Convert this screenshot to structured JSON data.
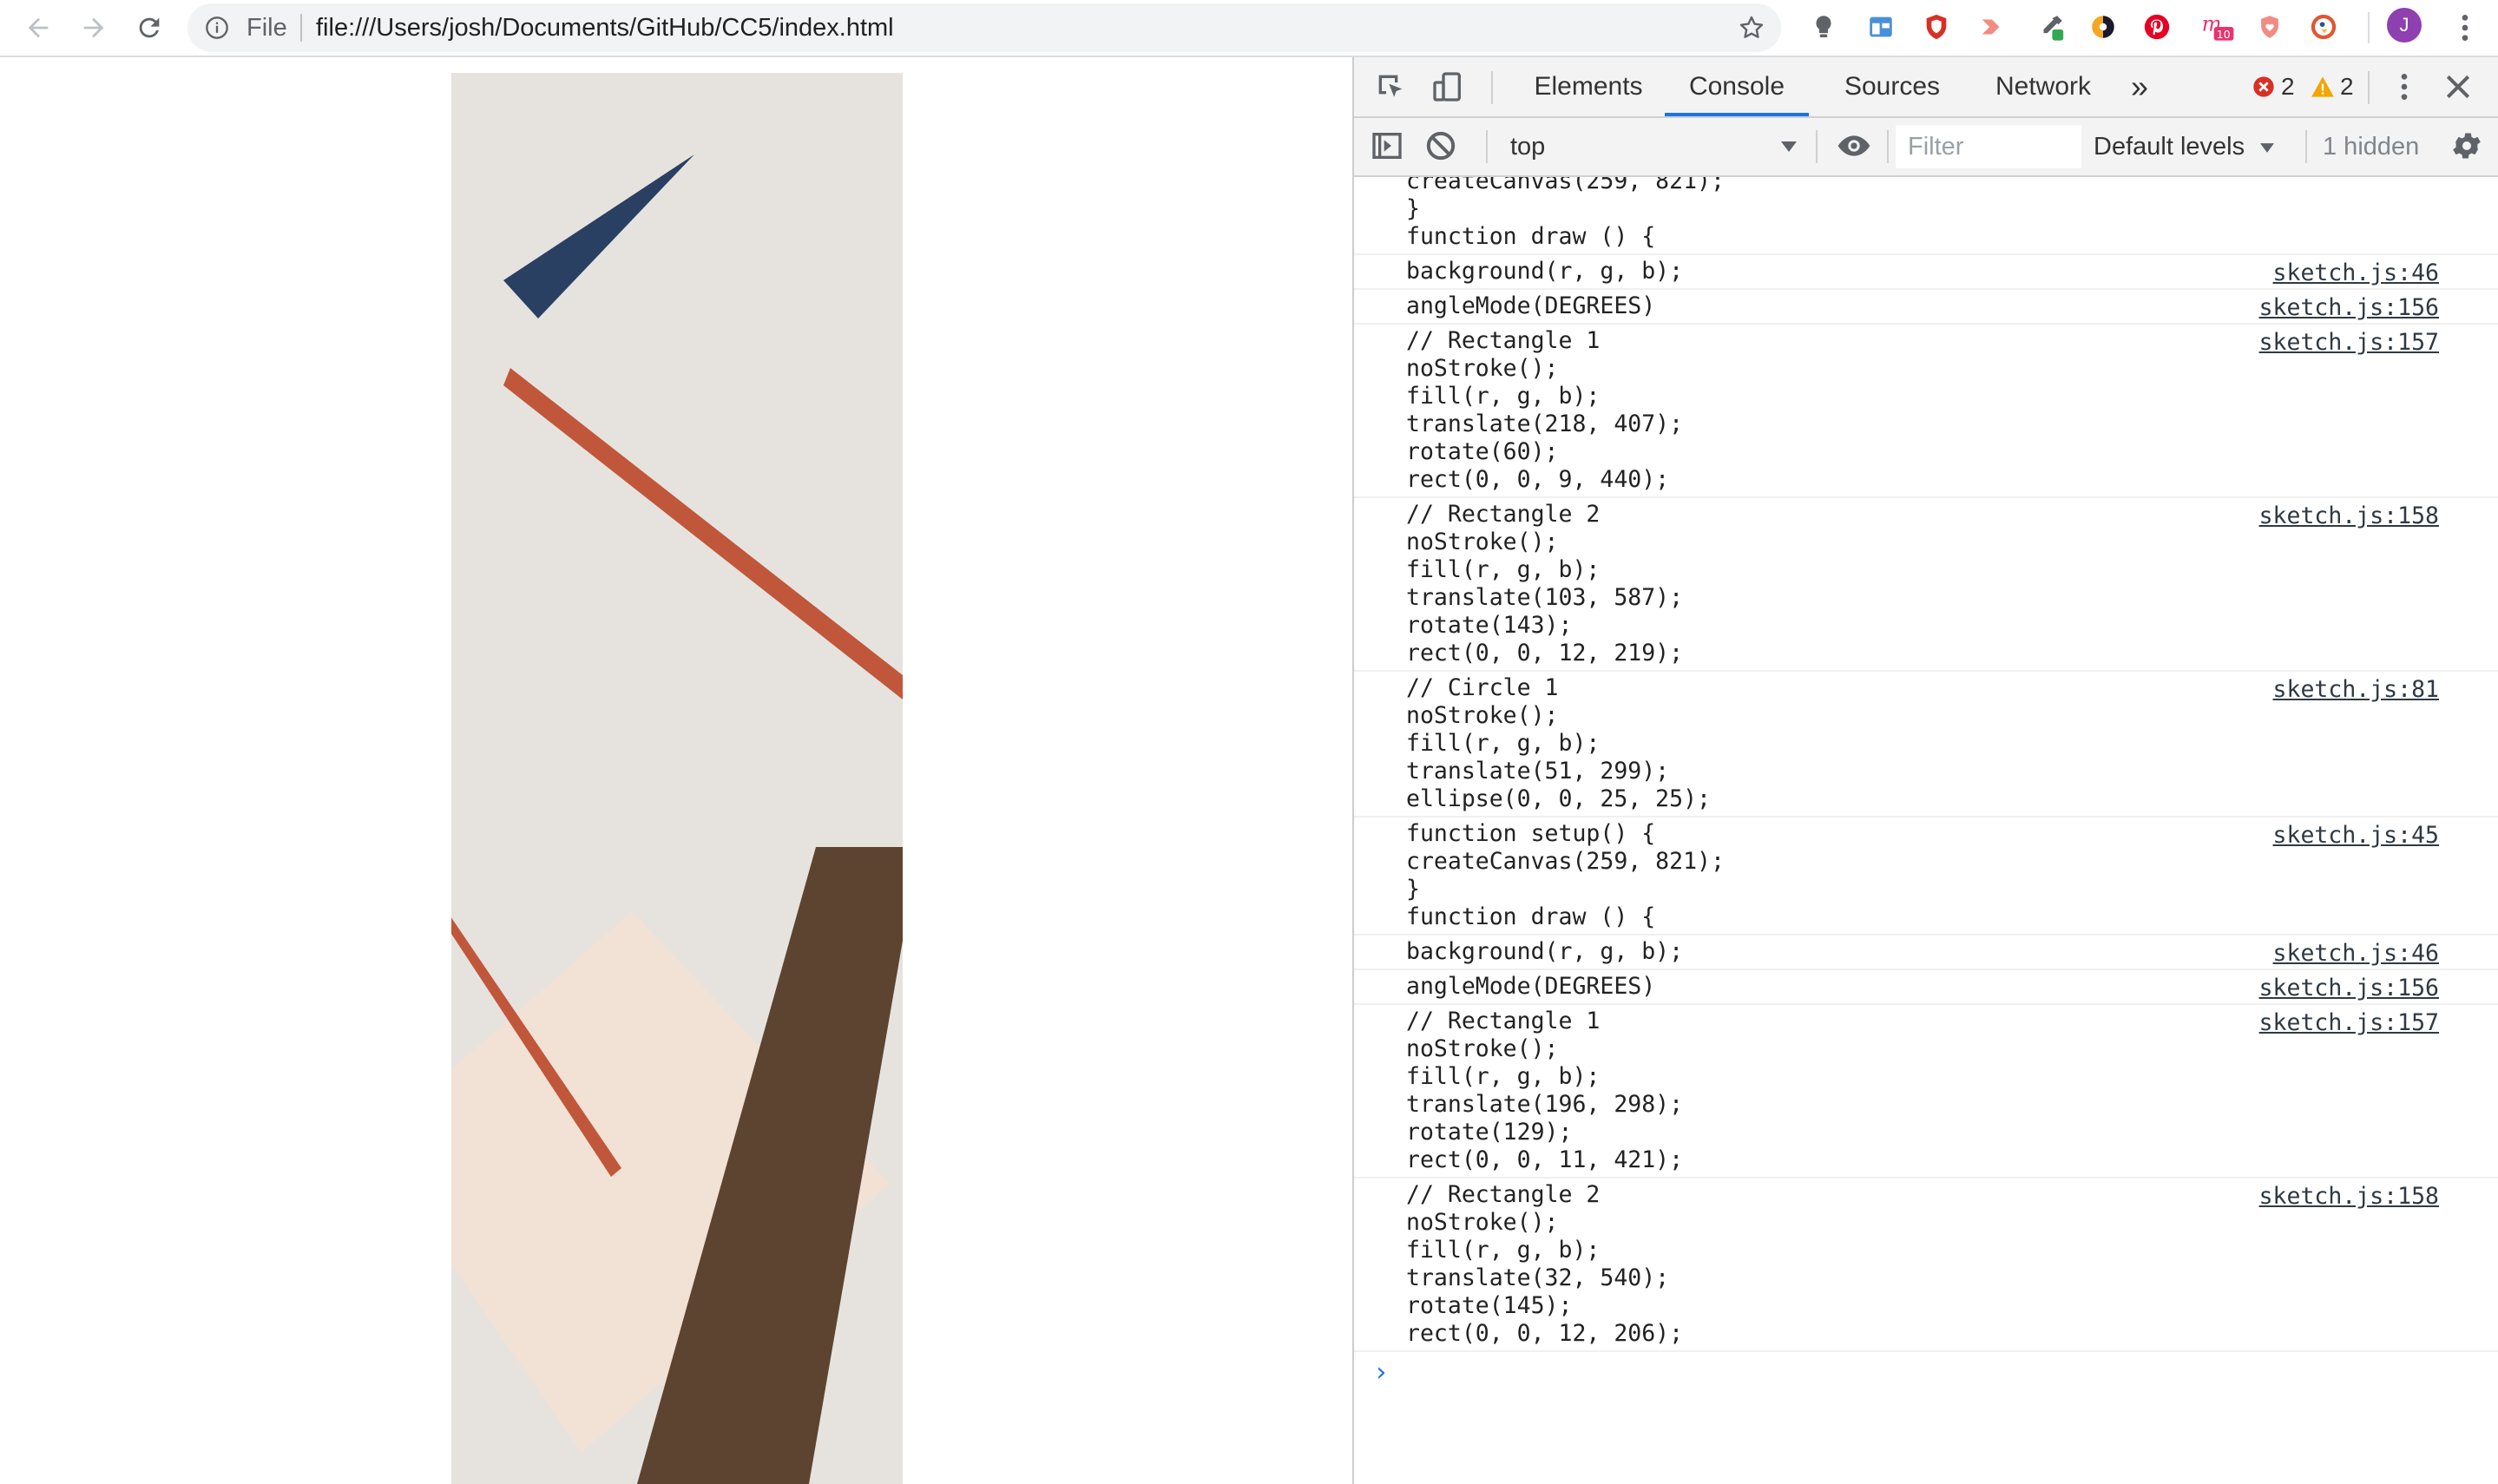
{
  "browser": {
    "omnibox": {
      "scheme_label": "File",
      "url": "file:///Users/josh/Documents/GitHub/CC5/index.html"
    },
    "profile_initial": "J"
  },
  "sketch": {
    "background_color": "#e6e3df",
    "colors": {
      "navy": "#2a4063",
      "rust": "#c0573a",
      "brown": "#5c4430",
      "peach": "#f2e1d5"
    }
  },
  "devtools": {
    "tabs": [
      {
        "label": "Elements"
      },
      {
        "label": "Console",
        "active": true
      },
      {
        "label": "Sources"
      },
      {
        "label": "Network"
      }
    ],
    "more_tabs": "»",
    "error_count": "2",
    "warning_count": "2",
    "toolbar": {
      "context": "top",
      "filter_placeholder": "Filter",
      "levels": "Default levels",
      "hidden": "1 hidden"
    },
    "console": {
      "messages": [
        {
          "text": "createCanvas(259, 821);\n}\nfunction draw () {",
          "src": ""
        },
        {
          "text": "background(r, g, b);",
          "src": "sketch.js:46"
        },
        {
          "text": "angleMode(DEGREES)",
          "src": "sketch.js:156"
        },
        {
          "text": "// Rectangle 1\nnoStroke();\nfill(r, g, b);\ntranslate(218, 407);\nrotate(60);\nrect(0, 0, 9, 440);",
          "src": "sketch.js:157"
        },
        {
          "text": "// Rectangle 2\nnoStroke();\nfill(r, g, b);\ntranslate(103, 587);\nrotate(143);\nrect(0, 0, 12, 219);",
          "src": "sketch.js:158"
        },
        {
          "text": "// Circle 1\nnoStroke();\nfill(r, g, b);\ntranslate(51, 299);\nellipse(0, 0, 25, 25);",
          "src": "sketch.js:81"
        },
        {
          "text": "function setup() {\ncreateCanvas(259, 821);\n}\nfunction draw () {",
          "src": "sketch.js:45"
        },
        {
          "text": "background(r, g, b);",
          "src": "sketch.js:46"
        },
        {
          "text": "angleMode(DEGREES)",
          "src": "sketch.js:156"
        },
        {
          "text": "// Rectangle 1\nnoStroke();\nfill(r, g, b);\ntranslate(196, 298);\nrotate(129);\nrect(0, 0, 11, 421);",
          "src": "sketch.js:157"
        },
        {
          "text": "// Rectangle 2\nnoStroke();\nfill(r, g, b);\ntranslate(32, 540);\nrotate(145);\nrect(0, 0, 12, 206);",
          "src": "sketch.js:158"
        }
      ],
      "prompt": "›"
    }
  }
}
